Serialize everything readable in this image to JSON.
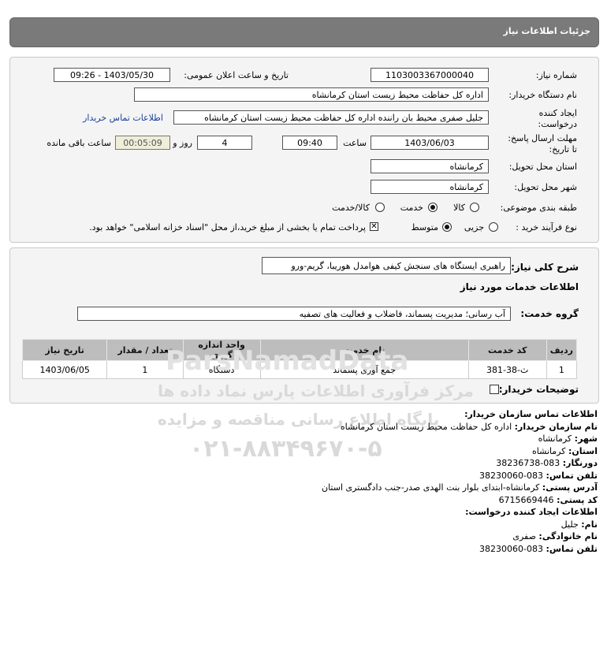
{
  "header": {
    "title": "جزئیات اطلاعات نیاز"
  },
  "form": {
    "need_number_label": "شماره نیاز:",
    "need_number": "1103003367000040",
    "announce_label": "تاریخ و ساعت اعلان عمومی:",
    "announce_value": "1403/05/30 - 09:26",
    "buyer_label": "نام دستگاه خریدار:",
    "buyer_value": "اداره کل حفاظت محیط زیست استان کرمانشاه",
    "creator_label_1": "ایجاد کننده",
    "creator_label_2": "درخواست:",
    "creator_value": "جلیل  صفری محیط بان راننده اداره کل حفاظت محیط زیست استان کرمانشاه",
    "contact_link": "اطلاعات تماس خریدار",
    "deadline_label_1": "مهلت ارسال پاسخ:",
    "deadline_label_2": "تا تاریخ:",
    "deadline_date": "1403/06/03",
    "time_label": "ساعت",
    "deadline_time": "09:40",
    "days_value": "4",
    "days_label": "روز و",
    "remaining_value": "00:05:09",
    "remaining_label": "ساعت باقی مانده",
    "province_label": "استان محل تحویل:",
    "province_value": "کرمانشاه",
    "city_label": "شهر محل تحویل:",
    "city_value": "کرمانشاه",
    "category_label": "طبقه بندی موضوعی:",
    "category_options": [
      "کالا",
      "خدمت",
      "کالا/خدمت"
    ],
    "category_selected": "خدمت",
    "process_label": "نوع فرآیند خرید :",
    "process_options": [
      "جزیی",
      "متوسط"
    ],
    "process_selected": "متوسط",
    "process_note": "پرداخت تمام یا بخشی از مبلغ خرید،از محل \"اسناد خزانه اسلامی\" خواهد بود."
  },
  "description": {
    "label": "شرح کلی نیاز:",
    "value": "راهبری ایستگاه های سنجش کیفی هوامدل هوریبا، گریم-ورو",
    "services_title": "اطلاعات خدمات مورد نیاز",
    "group_label": "گروه خدمت:",
    "group_value": "آب رسانی؛ مدیریت پسماند، فاضلاب و فعالیت های تصفیه"
  },
  "table": {
    "headers": [
      "ردیف",
      "کد خدمت",
      "نام خدمت",
      "واحد اندازه گیری",
      "تعداد / مقدار",
      "تاریخ نیاز"
    ],
    "rows": [
      [
        "1",
        "ث-38-381",
        "جمع آوری پسماند",
        "دستگاه",
        "1",
        "1403/06/05"
      ]
    ]
  },
  "buyer_notes_label": "توضیحات خریدار:",
  "contact": {
    "title": "اطلاعات تماس سازمان خریدار:",
    "org_label": "نام سازمان خریدار:",
    "org_value": "اداره کل حفاظت محیط زیست استان کرمانشاه",
    "city_label": "شهر:",
    "city_value": "کرمانشاه",
    "province_label": "استان:",
    "province_value": "کرمانشاه",
    "fax_label": "دورنگار:",
    "fax_value": "083-38236738",
    "phone_label": "تلفن تماس:",
    "phone_value": "083-38230060",
    "address_label": "آدرس پستی:",
    "address_value": "کرمانشاه-ابتدای بلوار بنت الهدی صدر-جنب دادگستری استان",
    "postal_label": "کد پستی:",
    "postal_value": "6715669446",
    "creator_title": "اطلاعات ایجاد کننده درخواست:",
    "name_label": "نام:",
    "name_value": "جلیل",
    "family_label": "نام خانوادگی:",
    "family_value": "صفری",
    "creator_phone_label": "تلفن تماس:",
    "creator_phone_value": "083-38230060"
  },
  "watermark": {
    "brand": "ParsNamadData",
    "line1": "مرکز فرآوری اطلاعات پارس نماد داده ها",
    "line2": "پایگاه اطلاع رسانی مناقصه و مزایده",
    "phone": "۰۲۱-۸۸۳۴۹۶۷۰-۵"
  }
}
